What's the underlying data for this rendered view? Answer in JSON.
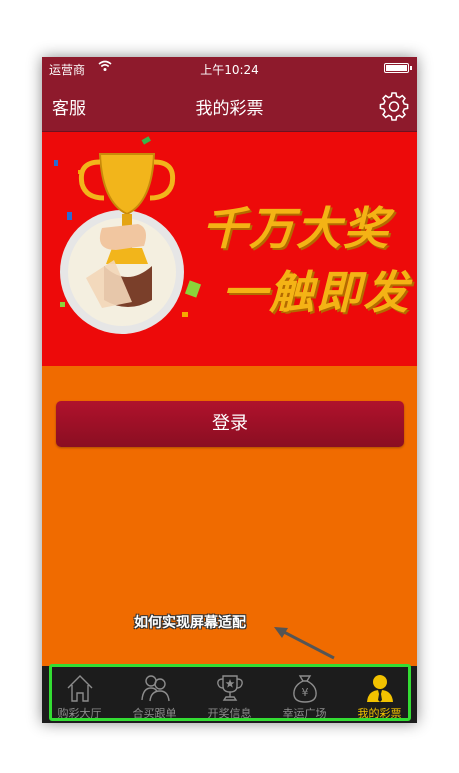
{
  "status_bar": {
    "carrier": "运营商",
    "time": "上午10:24"
  },
  "nav": {
    "left_label": "客服",
    "title": "我的彩票"
  },
  "banner": {
    "line1": "千万大奖",
    "line2": "一触即发"
  },
  "login": {
    "label": "登录"
  },
  "annotation": {
    "text": "如何实现屏幕适配"
  },
  "tabs": [
    {
      "label": "购彩大厅",
      "icon": "home-icon",
      "active": false
    },
    {
      "label": "合买跟单",
      "icon": "group-icon",
      "active": false
    },
    {
      "label": "开奖信息",
      "icon": "trophy-icon",
      "active": false
    },
    {
      "label": "幸运广场",
      "icon": "money-bag-icon",
      "active": false
    },
    {
      "label": "我的彩票",
      "icon": "user-icon",
      "active": true
    }
  ],
  "colors": {
    "nav_bg": "#8e1a2c",
    "banner_bg": "#ed0a0a",
    "page_bg": "#f06b00",
    "tabbar_bg": "#1c1c1c",
    "tab_active": "#f2c200",
    "highlight_border": "#33dd33"
  }
}
